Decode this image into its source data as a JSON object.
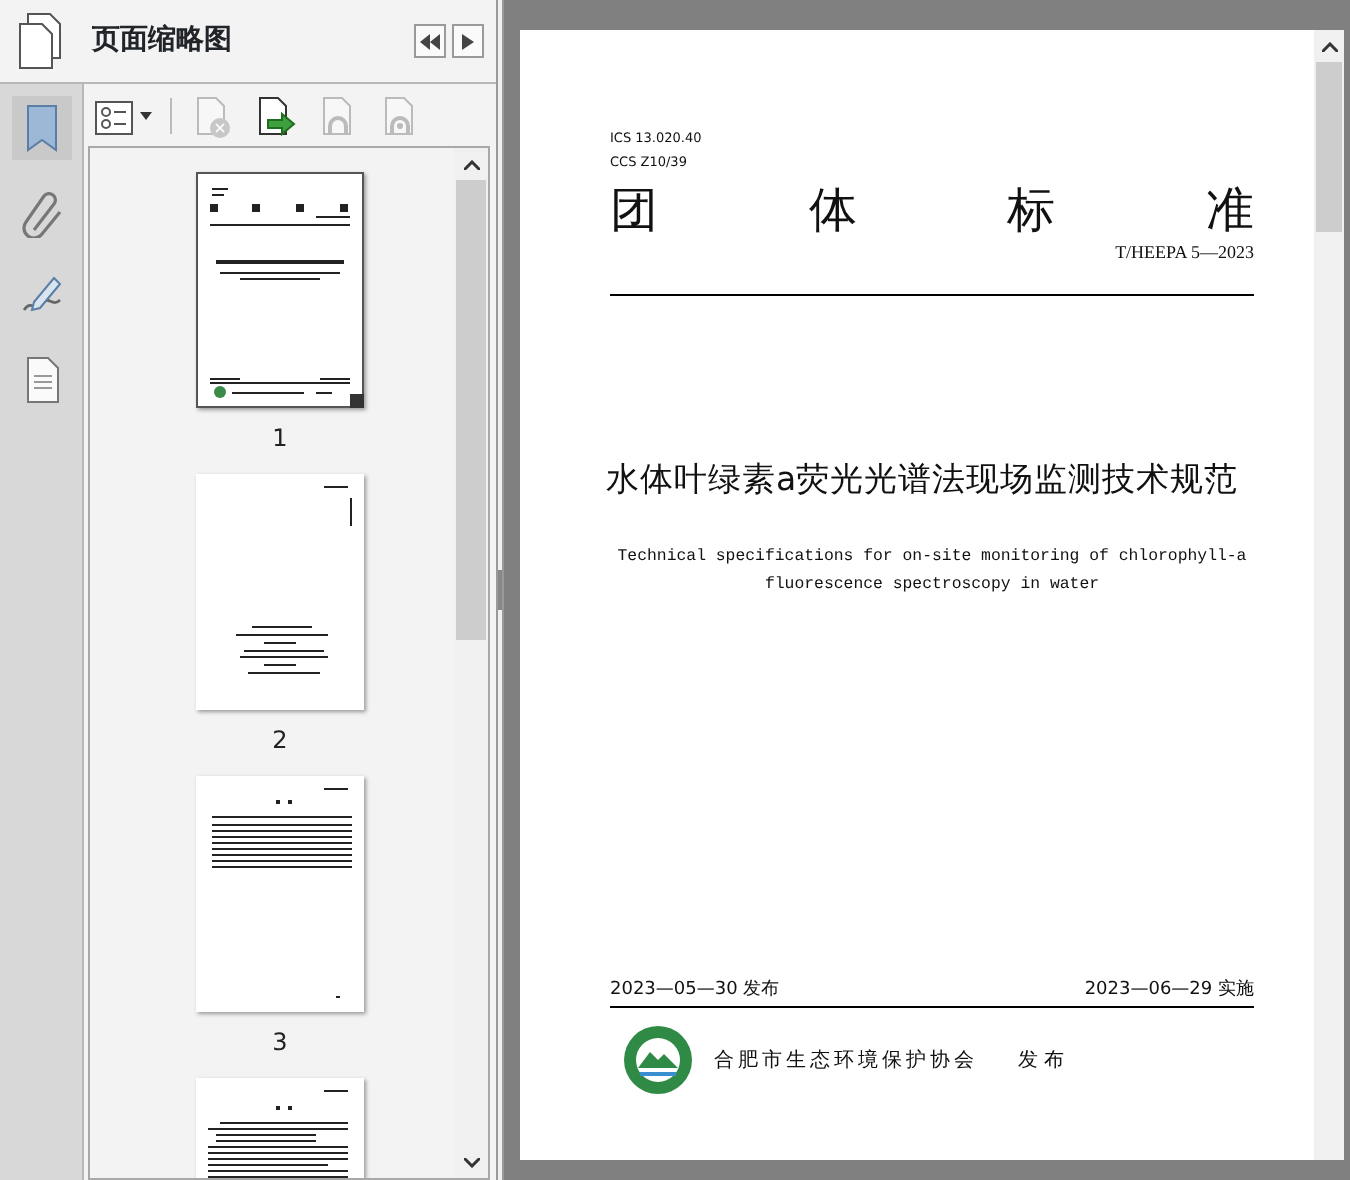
{
  "sidebar": {
    "tools": [
      {
        "kind": "bookmarks",
        "selected": true
      },
      {
        "kind": "attachments",
        "selected": false
      },
      {
        "kind": "signatures",
        "selected": false
      },
      {
        "kind": "layers",
        "selected": false
      }
    ]
  },
  "panel": {
    "title": "页面缩略图",
    "toolbar": [
      {
        "kind": "options",
        "disabled": false
      },
      {
        "kind": "delete",
        "disabled": true
      },
      {
        "kind": "insert",
        "disabled": false
      },
      {
        "kind": "undo",
        "disabled": true
      },
      {
        "kind": "redo",
        "disabled": true
      }
    ],
    "thumbnails": [
      {
        "kind": "cover",
        "number": "1",
        "selected": true
      },
      {
        "kind": "blank",
        "number": "2",
        "selected": false
      },
      {
        "kind": "contents",
        "number": "3",
        "selected": false
      },
      {
        "kind": "text",
        "selected": false
      }
    ]
  },
  "document": {
    "ics": "ICS 13.020.40",
    "ccs": "CCS Z10/39",
    "heading": "团 体 标 准",
    "code": "T/HEEPA 5—2023",
    "title": "水体叶绿素a荧光光谱法现场监测技术规范",
    "english_title": "Technical specifications for on-site monitoring of chlorophyll-a fluorescence spectroscopy in water",
    "issue_date": "2023—05—30 发布",
    "effective_date": "2023—06—29 实施",
    "publisher": "合肥市生态环境保护协会",
    "publish_label": "发 布"
  }
}
